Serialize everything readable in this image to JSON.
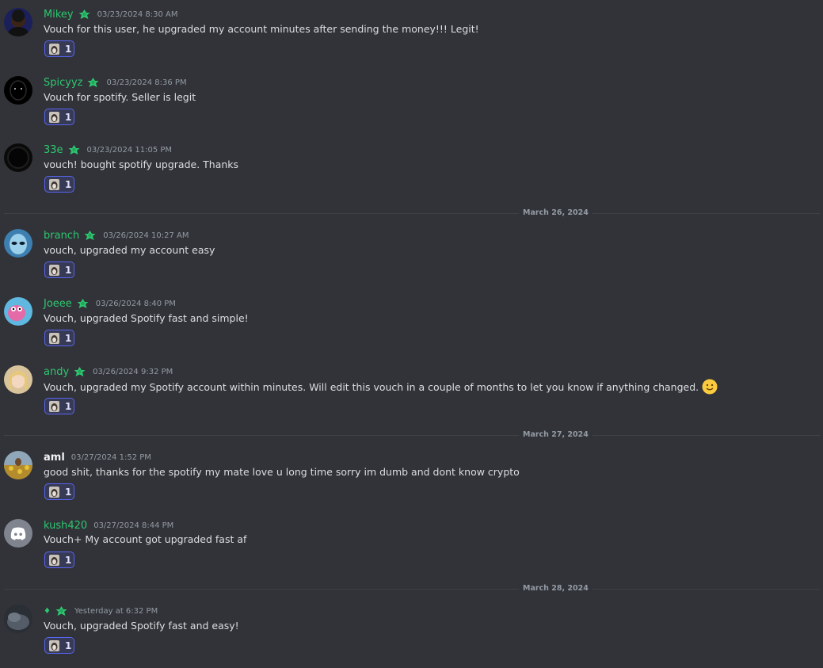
{
  "messages": [
    {
      "username": "Mikey",
      "time": "03/23/2024 8:30 AM",
      "text": "Vouch for this user, he upgraded my account minutes after sending the money!!! Legit!",
      "reaction_count": "1",
      "avatar": "avatar-dark-person"
    },
    {
      "username": "Spicyyz",
      "time": "03/23/2024 8:36 PM",
      "text": "Vouch for spotify. Seller is legit",
      "reaction_count": "1",
      "avatar": "avatar-black-face"
    },
    {
      "username": "33e",
      "time": "03/23/2024 11:05 PM",
      "text": "vouch! bought spotify upgrade. Thanks",
      "reaction_count": "1",
      "avatar": "avatar-black-circle"
    },
    {
      "username": "branch",
      "time": "03/26/2024 10:27 AM",
      "text": "vouch, upgraded my account easy",
      "reaction_count": "1",
      "avatar": "avatar-alien"
    },
    {
      "username": "Joeee",
      "time": "03/26/2024 8:40 PM",
      "text": "Vouch, upgraded Spotify fast and simple!",
      "reaction_count": "1",
      "avatar": "avatar-pink-dog"
    },
    {
      "username": "andy",
      "time": "03/26/2024 9:32 PM",
      "text": "Vouch, upgraded my Spotify account within minutes. Will edit this vouch in a couple of months to let you know if anything changed.",
      "reaction_count": "1",
      "avatar": "avatar-blonde",
      "emoji": "slightly-smiling-face-icon"
    },
    {
      "username": "aml",
      "time": "03/27/2024 1:52 PM",
      "text": "good shit, thanks for the spotify my mate love u long time sorry im dumb and dont know crypto",
      "reaction_count": "1",
      "avatar": "avatar-field"
    },
    {
      "username": "kush420",
      "time": "03/27/2024 8:44 PM",
      "text": "Vouch+ My account got upgraded fast af",
      "reaction_count": "1",
      "avatar": "discord-logo-icon"
    },
    {
      "username": "♦",
      "time": "Yesterday at 6:32 PM",
      "text": "Vouch, upgraded Spotify fast and easy!",
      "reaction_count": "1",
      "avatar": "avatar-dark-cloud"
    }
  ],
  "dividers": [
    "March 26, 2024",
    "March 27, 2024",
    "March 28, 2024"
  ],
  "colors": {
    "background": "#313338",
    "username": "#2dc770",
    "badge": "#2dc770",
    "reaction_border": "#5865f2",
    "text": "#dbdee1",
    "timestamp": "#949ba4"
  }
}
